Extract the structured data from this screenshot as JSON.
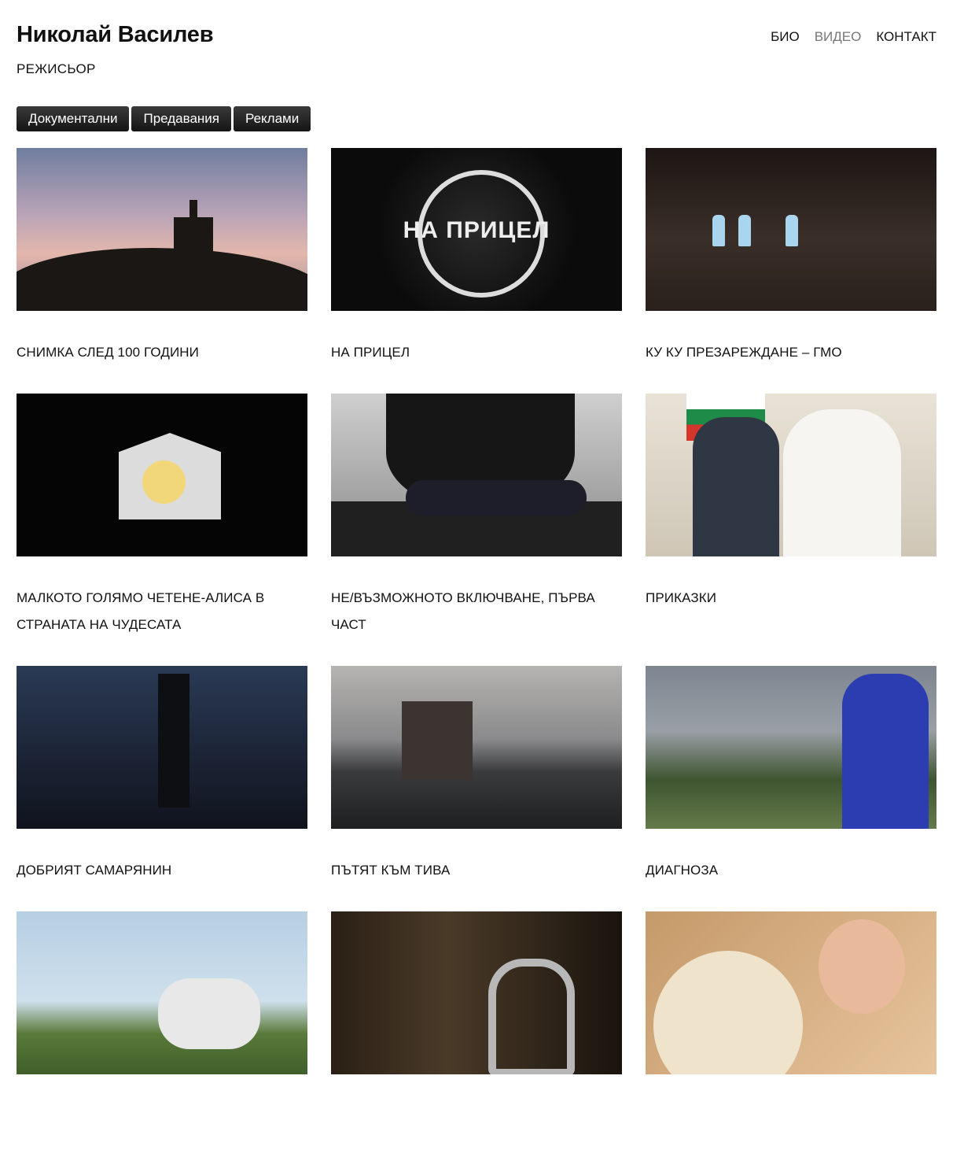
{
  "site": {
    "title": "Николай Василев",
    "subtitle": "РЕЖИСЬОР"
  },
  "nav": {
    "bio": "БИО",
    "video": "ВИДЕО",
    "contact": "КОНТАКТ",
    "active": "ВИДЕО"
  },
  "filters": [
    "Документални",
    "Предавания",
    "Реклами"
  ],
  "videos": [
    {
      "title": "СНИМКА СЛЕД 100 ГОДИНИ"
    },
    {
      "title": "НА ПРИЦЕЛ",
      "thumb_text": "НА ПРИЦЕЛ"
    },
    {
      "title": "КУ КУ ПРЕЗАРЕЖДАНЕ – ГМО"
    },
    {
      "title": "МАЛКОТО ГОЛЯМО ЧЕТЕНЕ-АЛИСА В СТРАНАТА НА ЧУДЕСАТА"
    },
    {
      "title": "НЕ/ВЪЗМОЖНОТО ВКЛЮЧВАНЕ, ПЪРВА ЧАСТ"
    },
    {
      "title": "ПРИКАЗКИ"
    },
    {
      "title": "ДОБРИЯТ САМАРЯНИН"
    },
    {
      "title": "ПЪТЯТ КЪМ ТИВА"
    },
    {
      "title": "ДИАГНОЗА"
    },
    {
      "title": ""
    },
    {
      "title": ""
    },
    {
      "title": ""
    }
  ]
}
